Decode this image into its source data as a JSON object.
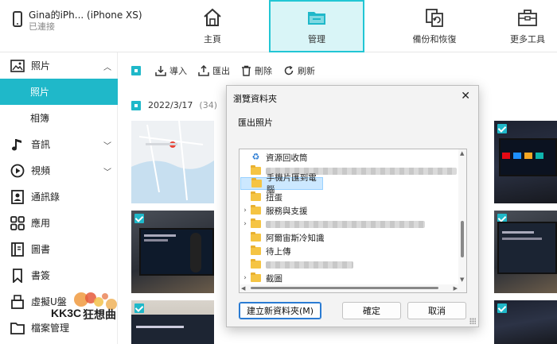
{
  "device": {
    "name": "Gina的iPh... (iPhone XS)",
    "status": "已連接"
  },
  "nav": [
    {
      "label": "主頁",
      "icon": "home-icon"
    },
    {
      "label": "管理",
      "icon": "folder-icon",
      "active": true
    },
    {
      "label": "備份和恢復",
      "icon": "backup-restore-icon"
    },
    {
      "label": "更多工具",
      "icon": "toolbox-icon"
    }
  ],
  "sidebar": {
    "items": [
      {
        "label": "照片",
        "icon": "image-icon",
        "expanded": true
      },
      {
        "label": "照片",
        "sub": true,
        "active": true
      },
      {
        "label": "相簿",
        "sub": true
      },
      {
        "label": "音訊",
        "icon": "music-note-icon"
      },
      {
        "label": "視頻",
        "icon": "play-circle-icon"
      },
      {
        "label": "通訊錄",
        "icon": "contact-card-icon"
      },
      {
        "label": "應用",
        "icon": "apps-grid-icon"
      },
      {
        "label": "圖書",
        "icon": "book-icon"
      },
      {
        "label": "書簽",
        "icon": "bookmark-icon"
      },
      {
        "label": "虛擬U盤",
        "icon": "usb-drive-icon"
      },
      {
        "label": "檔案管理",
        "icon": "file-folder-icon"
      }
    ]
  },
  "toolbar": {
    "import": "導入",
    "export": "匯出",
    "delete": "刪除",
    "refresh": "刷新"
  },
  "group": {
    "date": "2022/3/17",
    "count": "(34)"
  },
  "dialog": {
    "title": "瀏覽資料夾",
    "description": "匯出照片",
    "tree": [
      {
        "label": "資源回收筒",
        "type": "recycle",
        "expander": ""
      },
      {
        "label": "",
        "type": "blurred",
        "expander": ""
      },
      {
        "label": "手機片匯到電腦",
        "type": "folder",
        "expander": "",
        "selected": true
      },
      {
        "label": "扭蛋",
        "type": "folder",
        "expander": ""
      },
      {
        "label": "服務與支援",
        "type": "folder",
        "expander": "›"
      },
      {
        "label": "",
        "type": "blurred",
        "expander": "›"
      },
      {
        "label": "阿爾宙斯冷知識",
        "type": "folder",
        "expander": ""
      },
      {
        "label": "待上傳",
        "type": "folder",
        "expander": ""
      },
      {
        "label": "",
        "type": "blurred",
        "expander": ""
      },
      {
        "label": "截圖",
        "type": "folder",
        "expander": "›"
      }
    ],
    "new_folder": "建立新資料夾(M)",
    "ok": "確定",
    "cancel": "取消"
  },
  "colors": {
    "accent": "#1fb8c9",
    "highlight_border": "#22c6d4",
    "selection": "#cce8ff"
  },
  "watermark": "KK3C狂想曲"
}
